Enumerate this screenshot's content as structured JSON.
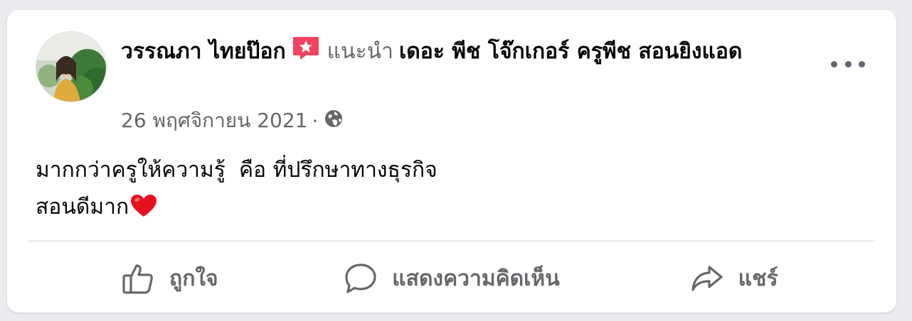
{
  "post": {
    "author": "วรรณภา ไทยป๊อก",
    "action_text": "แนะนำ",
    "page_name": "เดอะ พีช โจ๊กเกอร์ ครูพีช สอนยิงแอด",
    "date": "26 พฤศจิกายน 2021",
    "separator": "·",
    "body_line1": "มากกว่าครูให้ความรู้  คือ ที่ปรึกษาทางธุรกิจ",
    "body_line2": "สอนดีมาก"
  },
  "actions": {
    "like_label": "ถูกใจ",
    "comment_label": "แสดงความคิดเห็น",
    "share_label": "แชร์"
  },
  "icons": {
    "badge": "recommend-star-icon",
    "privacy": "globe-icon",
    "more": "more-options-icon",
    "emoji": "heart-emoji-icon",
    "like": "thumbs-up-icon",
    "comment": "speech-bubble-icon",
    "share": "share-arrow-icon"
  },
  "colors": {
    "badge": "#f3425f",
    "heart": "#e8101f",
    "secondary_text": "#65676b"
  }
}
